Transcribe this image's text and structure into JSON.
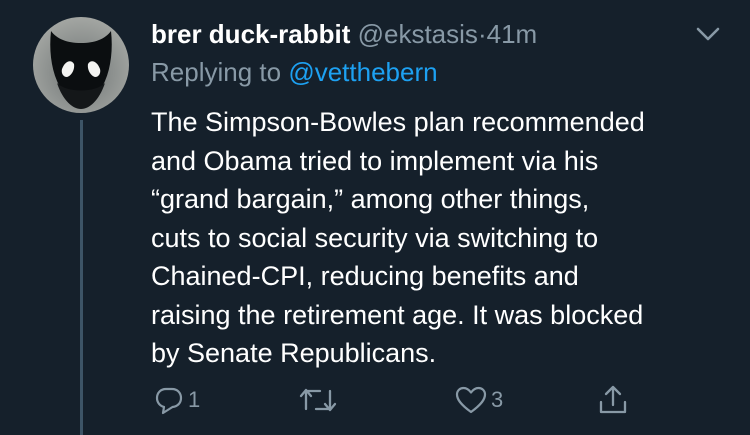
{
  "tweet": {
    "display_name": "brer duck-rabbit",
    "handle": "@ekstasis",
    "separator": "·",
    "time": "41m",
    "replying_label": "Replying to",
    "replying_handle": "@vetthebern",
    "body_lines": [
      "The Simpson-Bowles plan recommended",
      "and Obama tried to implement via his",
      "“grand bargain,” among other things,",
      "cuts to social security via switching to",
      "Chained-CPI, reducing benefits and",
      "raising the retirement age. It was blocked",
      "by Senate Republicans."
    ]
  },
  "actions": {
    "reply_icon": "reply-icon",
    "reply_count": "1",
    "retweet_icon": "retweet-icon",
    "like_icon": "like-icon",
    "like_count": "3",
    "share_icon": "share-icon"
  },
  "colors": {
    "background": "#15202b",
    "primary_text": "#ffffff",
    "secondary_text": "#8899a6",
    "link": "#1da1f2",
    "thread_line": "#3d5466"
  }
}
